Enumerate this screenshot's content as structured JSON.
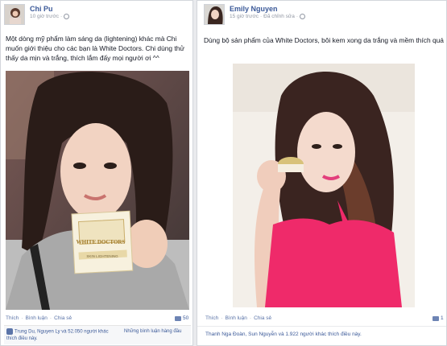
{
  "left_post": {
    "author": "Chi Pu",
    "time": "10 giờ trước",
    "text": "Một dòng mỹ phẩm làm sáng da (lightening) khác mà Chi muốn giới thiệu cho các bạn là White Doctors. Chi dùng thử thấy da mịn và trắng, thích lắm đấy mọi người ơi ^^",
    "actions": [
      "Thích",
      "Bình luận",
      "Chia sẻ"
    ],
    "comment_count": "50",
    "likes_text": "Trung Du, Nguyen Ly và 52.050 người khác thích điều này.",
    "more_comments": "Những bình luận hàng đầu"
  },
  "right_post": {
    "author": "Emily Nguyen",
    "time": "15 giờ trước",
    "edited": "Đã chỉnh sửa",
    "text": "Dùng bộ sản phẩm của White Doctors, bôi kem xong da trắng và mềm thích quá",
    "actions": [
      "Thích",
      "Bình luận",
      "Chia sẻ"
    ],
    "comment_count": "1",
    "likes_text": "Thanh Nga Đoàn, Sun Nguyễn và 1.922 người khác thích điều này."
  },
  "product": {
    "brand": "WHITE DOCTORS",
    "line": "SKIN LIGHTENING"
  },
  "colors": {
    "link": "#3b5998",
    "muted": "#9197a3",
    "border": "#d3d6db",
    "right_bg": "#f3efe9",
    "top_pink": "#ef2a6a"
  }
}
